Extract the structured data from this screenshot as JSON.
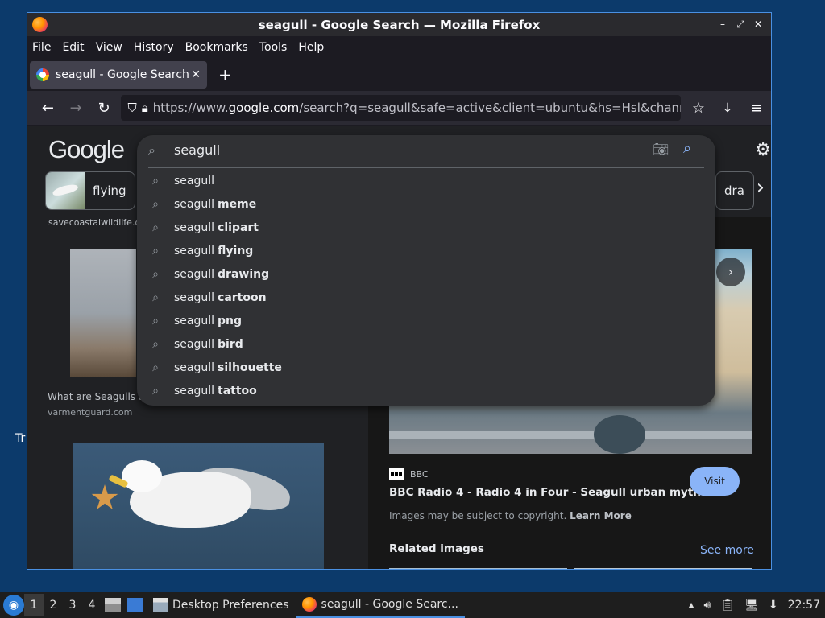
{
  "desktop": {
    "stray_text": "Tr"
  },
  "window": {
    "title": "seagull - Google Search — Mozilla Firefox",
    "controls": {
      "minimize": "–",
      "restore": "⤢",
      "close": "✕"
    }
  },
  "menubar": {
    "items": [
      {
        "label": "File"
      },
      {
        "label": "Edit"
      },
      {
        "label": "View"
      },
      {
        "label": "History"
      },
      {
        "label": "Bookmarks"
      },
      {
        "label": "Tools"
      },
      {
        "label": "Help"
      }
    ]
  },
  "tab": {
    "label": "seagull - Google Search",
    "close": "✕",
    "new_tab": "+"
  },
  "navbar": {
    "url_prefix": "https://www.",
    "url_host": "google.com",
    "url_rest": "/search?q=seagull&safe=active&client=ubuntu&hs=Hsl&channe"
  },
  "google": {
    "logo": "Google",
    "search_value": "seagull",
    "chips": [
      {
        "label": "flying"
      },
      {
        "label": "dra"
      }
    ],
    "suggestions": [
      {
        "base": "seagull",
        "bold": ""
      },
      {
        "base": "seagull",
        "bold": "meme"
      },
      {
        "base": "seagull",
        "bold": "clipart"
      },
      {
        "base": "seagull",
        "bold": "flying"
      },
      {
        "base": "seagull",
        "bold": "drawing"
      },
      {
        "base": "seagull",
        "bold": "cartoon"
      },
      {
        "base": "seagull",
        "bold": "png"
      },
      {
        "base": "seagull",
        "bold": "bird"
      },
      {
        "base": "seagull",
        "bold": "silhouette"
      },
      {
        "base": "seagull",
        "bold": "tattoo"
      }
    ]
  },
  "results": {
    "top_source": "savecoastalwildlife.o",
    "item1_caption": "What are Seagulls ar",
    "item1_source": "varmentguard.com"
  },
  "panel": {
    "source": "BBC",
    "title": "BBC Radio 4 - Radio 4 in Four - Seagull urban myths:...",
    "visit": "Visit",
    "copyright": "Images may be subject to copyright.",
    "learn_more": "Learn More",
    "related": "Related images",
    "see_more": "See more"
  },
  "taskbar": {
    "workspaces": [
      "1",
      "2",
      "3",
      "4"
    ],
    "tasks": [
      {
        "label": "Desktop Preferences"
      },
      {
        "label": "seagull - Google Searc..."
      }
    ],
    "clock": "22:57"
  }
}
